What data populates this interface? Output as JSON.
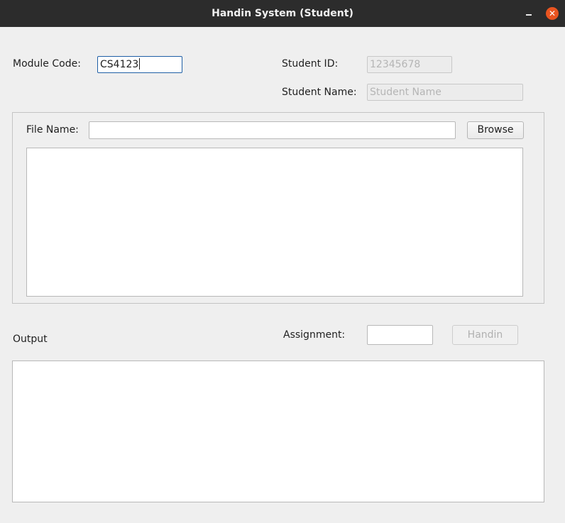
{
  "window": {
    "title": "Handin System (Student)",
    "close_glyph": "✕",
    "accent_color": "#e95420"
  },
  "form": {
    "module_code_label": "Module Code:",
    "module_code_value": "CS4123",
    "student_id_label": "Student ID:",
    "student_id_placeholder": "12345678",
    "student_name_label": "Student Name:",
    "student_name_placeholder": "Student Name"
  },
  "file": {
    "label": "File Name:",
    "value": "",
    "browse_label": "Browse",
    "file_list_content": ""
  },
  "output": {
    "label": "Output",
    "assignment_label": "Assignment:",
    "assignment_value": "",
    "handin_label": "Handin",
    "output_content": ""
  },
  "icons": {
    "minimize": "minimize-icon",
    "close": "close-icon"
  }
}
